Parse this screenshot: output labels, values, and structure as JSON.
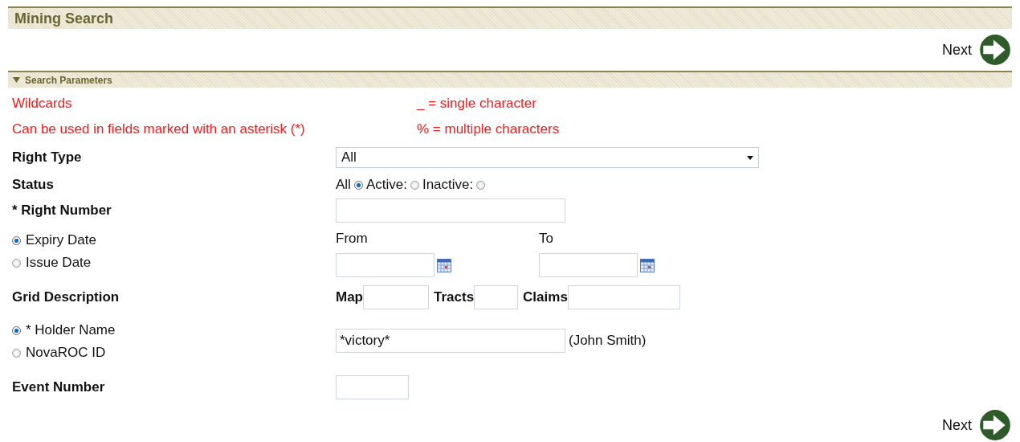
{
  "title": "Mining Search",
  "top_next": {
    "label": "Next"
  },
  "section": {
    "title": "Search Parameters",
    "expanded": true
  },
  "wildcards": {
    "title": "Wildcards",
    "note": "Can be used in fields marked with an asterisk (*)",
    "rules": [
      "_ = single character",
      "% = multiple characters"
    ]
  },
  "right_type": {
    "label": "Right Type",
    "value": "All"
  },
  "status": {
    "label": "Status",
    "options": [
      {
        "label": "All",
        "selected": true
      },
      {
        "label": "Active:",
        "selected": false
      },
      {
        "label": "Inactive:",
        "selected": false
      }
    ]
  },
  "right_number": {
    "label": "* Right Number"
  },
  "date": {
    "options": [
      {
        "label": "Expiry Date",
        "selected": true
      },
      {
        "label": "Issue Date",
        "selected": false
      }
    ],
    "from_label": "From",
    "to_label": "To"
  },
  "grid": {
    "label": "Grid Description",
    "fields": [
      {
        "label": "Map",
        "kind": "map"
      },
      {
        "label": "Tracts",
        "kind": "tracts"
      },
      {
        "label": "Claims",
        "kind": "claims"
      }
    ]
  },
  "holder": {
    "options": [
      {
        "label": "* Holder Name",
        "selected": true
      },
      {
        "label": "NovaROC ID",
        "selected": false
      }
    ],
    "value": "*victory*",
    "example": "(John Smith)"
  },
  "event": {
    "label": "Event Number"
  },
  "bottom_next": {
    "label": "Next"
  }
}
